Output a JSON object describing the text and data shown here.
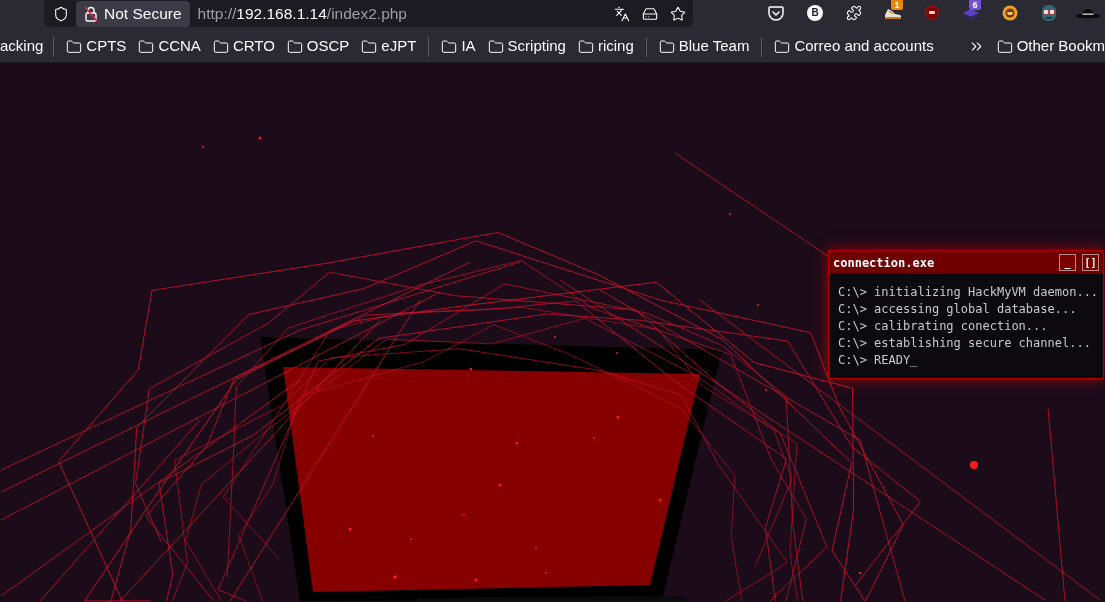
{
  "toolbar": {
    "security_label": "Not Secure",
    "url": {
      "scheme": "http://",
      "host": "192.168.1.14",
      "path": "/index2.php"
    },
    "extension_letter": "B",
    "extension_badges": [
      "1",
      "6"
    ]
  },
  "bookmarks_bar": {
    "items": [
      {
        "kind": "partial",
        "label": "acking"
      },
      {
        "kind": "separator"
      },
      {
        "kind": "folder",
        "label": "CPTS"
      },
      {
        "kind": "folder",
        "label": "CCNA"
      },
      {
        "kind": "folder",
        "label": "CRTO"
      },
      {
        "kind": "folder",
        "label": "OSCP"
      },
      {
        "kind": "folder",
        "label": "eJPT"
      },
      {
        "kind": "separator"
      },
      {
        "kind": "folder",
        "label": "IA"
      },
      {
        "kind": "folder",
        "label": "Scripting"
      },
      {
        "kind": "folder",
        "label": "ricing"
      },
      {
        "kind": "separator"
      },
      {
        "kind": "folder",
        "label": "Blue Team"
      },
      {
        "kind": "separator"
      },
      {
        "kind": "folder",
        "label": "Correo and accounts"
      }
    ],
    "other_bookmarks": "Other Bookm"
  },
  "terminal_window": {
    "title": "connection.exe",
    "controls": [
      "_",
      "[]"
    ],
    "lines": [
      "C:\\> initializing HackMyVM daemon...",
      "C:\\> accessing global database...",
      "C:\\> calibrating conection...",
      "C:\\> establishing secure channel...",
      "C:\\> READY_"
    ]
  }
}
